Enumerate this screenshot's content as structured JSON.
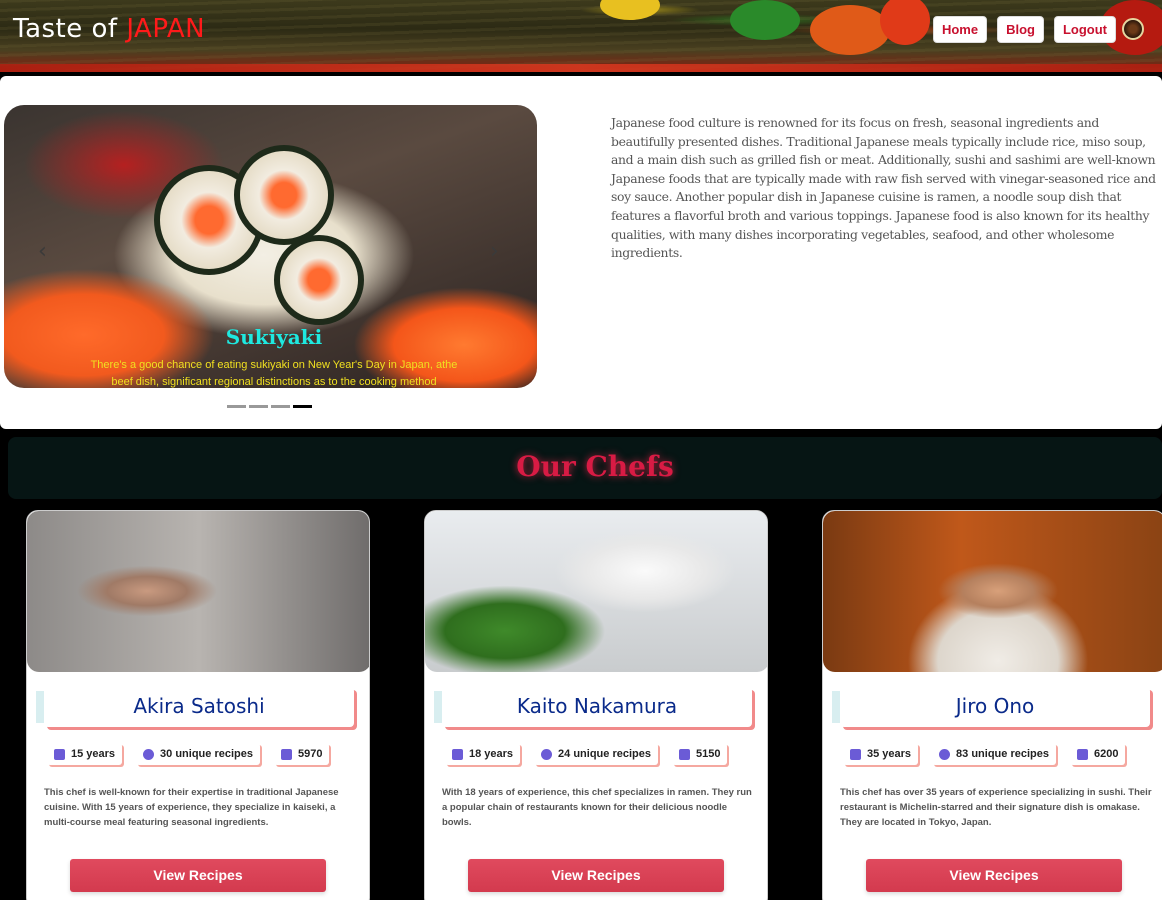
{
  "header": {
    "brand_prefix": "Taste of ",
    "brand_accent": "JAPAN",
    "nav": [
      {
        "label": "Home"
      },
      {
        "label": "Blog"
      },
      {
        "label": "Logout"
      }
    ]
  },
  "hero": {
    "slide": {
      "title": "Sukiyaki",
      "text": "There's a good chance of eating sukiyaki on New Year's Day in Japan, athe beef dish, significant regional distinctions as to the cooking method"
    },
    "indicator_count": 4,
    "active_indicator": 4,
    "intro": "Japanese food culture is renowned for its focus on fresh, seasonal ingredients and beautifully presented dishes. Traditional Japanese meals typically include rice, miso soup, and a main dish such as grilled fish or meat. Additionally, sushi and sashimi are well-known Japanese foods that are typically made with raw fish served with vinegar-seasoned rice and soy sauce. Another popular dish in Japanese cuisine is ramen, a noodle soup dish that features a flavorful broth and various toppings. Japanese food is also known for its healthy qualities, with many dishes incorporating vegetables, seafood, and other wholesome ingredients."
  },
  "chefs": {
    "title": "Our Chefs",
    "cards": [
      {
        "name": "Akira Satoshi",
        "years": "15 years",
        "recipes": "30 unique recipes",
        "likes": "5970",
        "bio": "This chef is well-known for their expertise in traditional Japanese cuisine. With 15 years of experience, they specialize in kaiseki, a multi-course meal featuring seasonal ingredients.",
        "button": "View Recipes"
      },
      {
        "name": "Kaito Nakamura",
        "years": "18 years",
        "recipes": "24 unique recipes",
        "likes": "5150",
        "bio": "With 18 years of experience, this chef specializes in ramen. They run a popular chain of restaurants known for their delicious noodle bowls.",
        "button": "View Recipes"
      },
      {
        "name": "Jiro Ono",
        "years": "35 years",
        "recipes": "83 unique recipes",
        "likes": "6200",
        "bio": "This chef has over 35 years of experience specializing in sushi. Their restaurant is Michelin-starred and their signature dish is omakase. They are located in Tokyo, Japan.",
        "button": "View Recipes"
      }
    ]
  },
  "colors": {
    "accent_red": "#c8102e",
    "button_red": "#d33a4e",
    "caption_cyan": "#1ee9e0",
    "caption_yellow": "#f0e020",
    "chef_name_blue": "#0a2a8a"
  },
  "icons": [
    "briefcase-icon",
    "cookie-icon",
    "thumbs-up-icon",
    "chevron-left-icon",
    "chevron-right-icon"
  ]
}
